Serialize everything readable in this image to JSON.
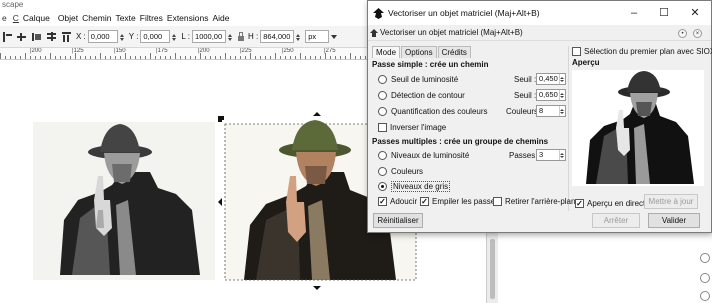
{
  "window": {
    "title": "scape"
  },
  "menu": [
    "e",
    "Calque",
    "Objet",
    "Chemin",
    "Texte",
    "Filtres",
    "Extensions",
    "Aide"
  ],
  "toolbar": {
    "x_label": "X :",
    "x_value": "0,000",
    "y_label": "Y :",
    "y_value": "0,000",
    "l_label": "L :",
    "l_value": "1000,00",
    "h_label": "H :",
    "h_value": "864,000",
    "unit": "px"
  },
  "ruler": [
    "|200",
    "|125",
    "|150",
    "|175",
    "|200",
    "|225",
    "|250",
    "|275"
  ],
  "dialog": {
    "window_title": "Vectoriser un objet matriciel (Maj+Alt+B)",
    "panel_title": "Vectoriser un objet matriciel (Maj+Alt+B)",
    "tabs": [
      "Mode",
      "Options",
      "Crédits"
    ],
    "single_scan": {
      "header": "Passe simple : crée un chemin",
      "options": [
        {
          "label": "Seuil de luminosité",
          "param": "Seuil :",
          "value": "0,450",
          "selected": false
        },
        {
          "label": "Détection de contour",
          "param": "Seuil :",
          "value": "0,650",
          "selected": false
        },
        {
          "label": "Quantification des couleurs",
          "param": "Couleurs :",
          "value": "8",
          "selected": false
        }
      ],
      "invert_label": "Inverser l'image",
      "invert_checked": false
    },
    "multiple_scans": {
      "header": "Passes multiples : crée un groupe de chemins",
      "options": [
        {
          "label": "Niveaux de luminosité",
          "selected": false
        },
        {
          "label": "Couleurs",
          "selected": false
        },
        {
          "label": "Niveaux de gris",
          "selected": true
        }
      ],
      "passes_label": "Passes :",
      "passes_value": "3",
      "smooth_label": "Adoucir",
      "smooth_checked": true,
      "stack_label": "Empiler les passes",
      "stack_checked": true,
      "remove_bg_label": "Retirer l'arrière-plan",
      "remove_bg_checked": false
    },
    "siox_label": "Sélection du premier plan avec SIOX",
    "siox_checked": false,
    "preview_header": "Aperçu",
    "live_preview_label": "Aperçu en direct",
    "live_preview_checked": true,
    "update_button": "Mettre à jour",
    "reset_button": "Réinitialiser",
    "stop_button": "Arrêter",
    "ok_button": "Valider"
  },
  "colors": {
    "accent": "#0078d7",
    "hat_color": "#5c6a3a",
    "dialog_bg": "#f0f0f0"
  }
}
